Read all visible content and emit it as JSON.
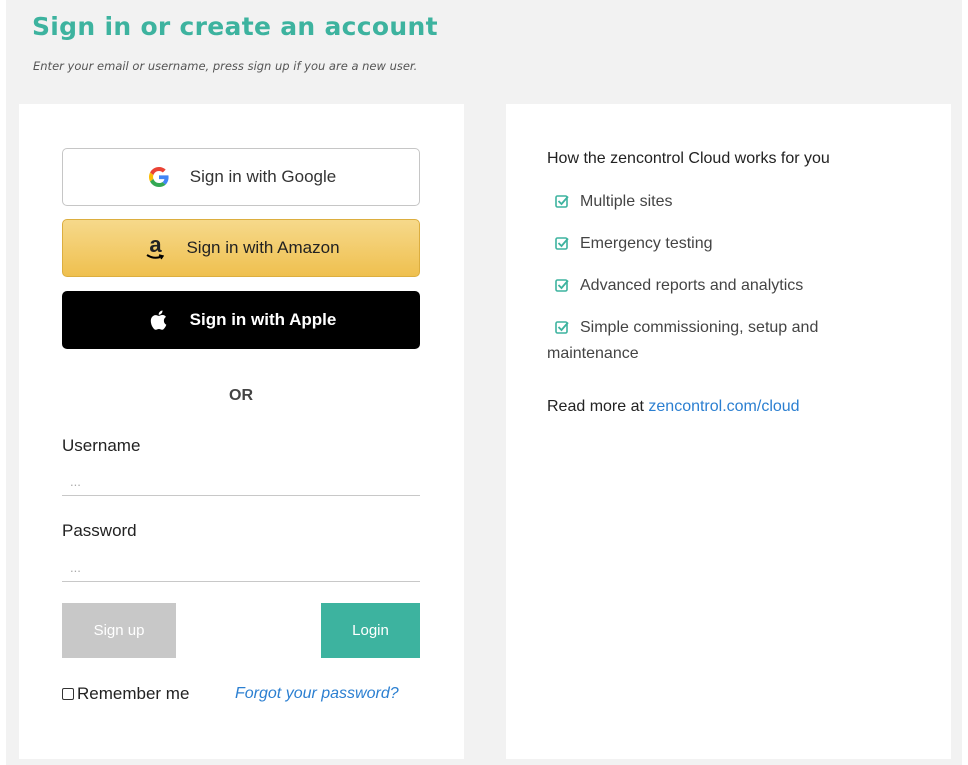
{
  "header": {
    "title": "Sign in or create an account",
    "subtitle": "Enter your email or username, press sign up if you are a new user."
  },
  "sso": {
    "google_label": "Sign in with Google",
    "amazon_label": "Sign in with Amazon",
    "apple_label": "Sign in with Apple"
  },
  "or_label": "OR",
  "form": {
    "username_label": "Username",
    "username_placeholder": "...",
    "password_label": "Password",
    "password_placeholder": "...",
    "signup_label": "Sign up",
    "login_label": "Login",
    "remember_label": "Remember me",
    "forgot_label": "Forgot your password?"
  },
  "info": {
    "heading": "How the zencontrol Cloud works for you",
    "features": [
      "Multiple sites",
      "Emergency testing",
      "Advanced reports and analytics",
      "Simple commissioning, setup and maintenance"
    ],
    "read_more_prefix": "Read more at",
    "read_more_link": "zencontrol.com/cloud"
  },
  "colors": {
    "accent": "#3db39f",
    "link": "#2b7fd1",
    "amazon": "#efc04f",
    "disabled": "#c8c8c8"
  }
}
